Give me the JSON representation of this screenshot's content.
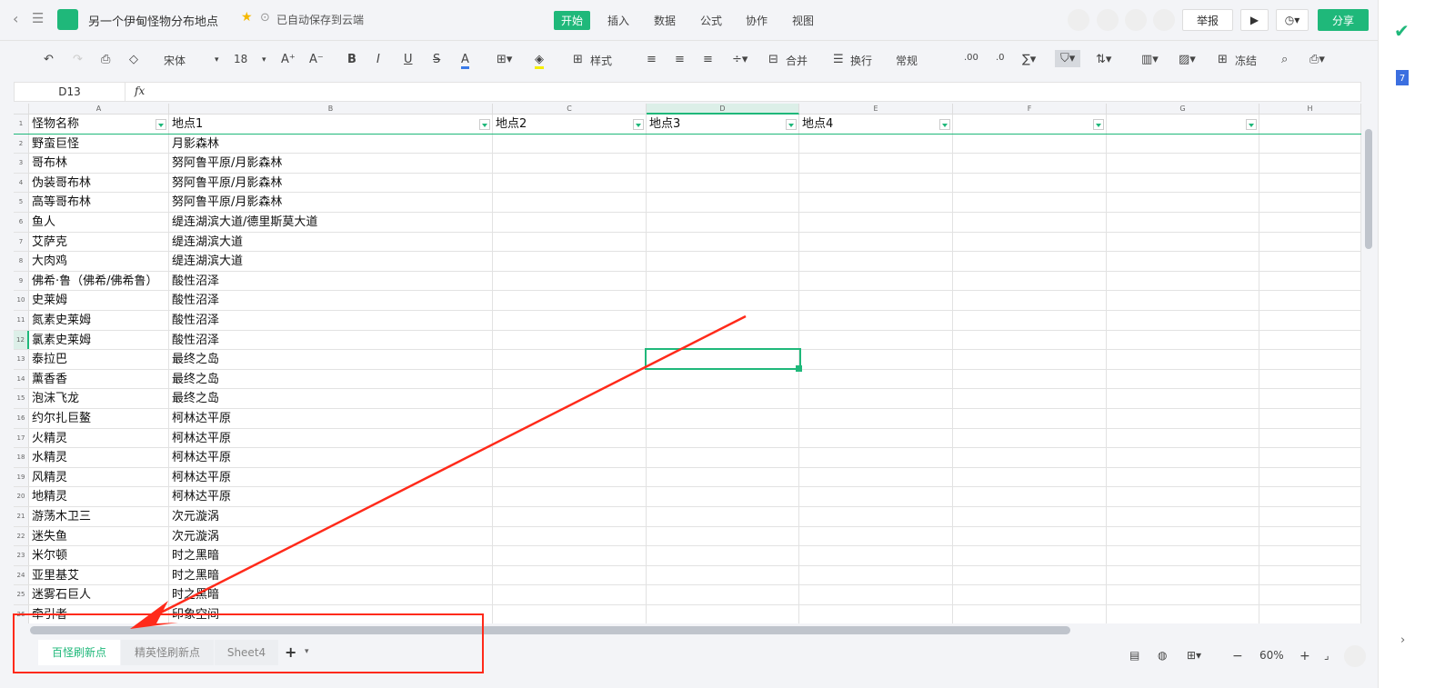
{
  "header": {
    "title": "另一个伊甸怪物分布地点",
    "save_status": "已自动保存到云端",
    "menus": [
      "开始",
      "插入",
      "数据",
      "公式",
      "协作",
      "视图"
    ],
    "report": "举报",
    "share": "分享"
  },
  "toolbar": {
    "font": "宋体",
    "size": "18",
    "style": "样式",
    "merge": "合并",
    "wrap": "换行",
    "format": "常规",
    "freeze": "冻结"
  },
  "formula_bar": {
    "cell_ref": "D13",
    "fx": "fx",
    "value": ""
  },
  "columns": [
    "A",
    "B",
    "C",
    "D",
    "E",
    "F",
    "G",
    "H"
  ],
  "rows": [
    [
      "怪物名称",
      "地点1",
      "地点2",
      "地点3",
      "地点4"
    ],
    [
      "野蛮巨怪",
      "月影森林"
    ],
    [
      "哥布林",
      "努阿鲁平原/月影森林"
    ],
    [
      "伪装哥布林",
      "努阿鲁平原/月影森林"
    ],
    [
      "高等哥布林",
      "努阿鲁平原/月影森林"
    ],
    [
      "鱼人",
      "缇连湖滨大道/德里斯莫大道"
    ],
    [
      "艾萨克",
      "缇连湖滨大道"
    ],
    [
      "大肉鸡",
      "缇连湖滨大道"
    ],
    [
      "佛希·鲁（佛希/佛希鲁）",
      "酸性沼泽"
    ],
    [
      "史莱姆",
      "酸性沼泽"
    ],
    [
      "氮素史莱姆",
      "酸性沼泽"
    ],
    [
      "氯素史莱姆",
      "酸性沼泽"
    ],
    [
      "泰拉巴",
      "最终之岛"
    ],
    [
      "薰香香",
      "最终之岛"
    ],
    [
      "泡沫飞龙",
      "最终之岛"
    ],
    [
      "约尔扎巨鳌",
      "柯林达平原"
    ],
    [
      "火精灵",
      "柯林达平原"
    ],
    [
      "水精灵",
      "柯林达平原"
    ],
    [
      "风精灵",
      "柯林达平原"
    ],
    [
      "地精灵",
      "柯林达平原"
    ],
    [
      "游荡木卫三",
      "次元漩涡"
    ],
    [
      "迷失鱼",
      "次元漩涡"
    ],
    [
      "米尔顿",
      "时之黑暗"
    ],
    [
      "亚里基艾",
      "时之黑暗"
    ],
    [
      "迷雾石巨人",
      "时之黑暗"
    ],
    [
      "牵引者",
      "印象空间"
    ]
  ],
  "sheets": {
    "tabs": [
      "百怪刷新点",
      "精英怪刷新点",
      "Sheet4"
    ],
    "active": 0,
    "add": "+"
  },
  "status": {
    "zoom": "60%"
  },
  "colors": {
    "accent": "#1fb87a",
    "annotation": "#ff2a1a"
  }
}
